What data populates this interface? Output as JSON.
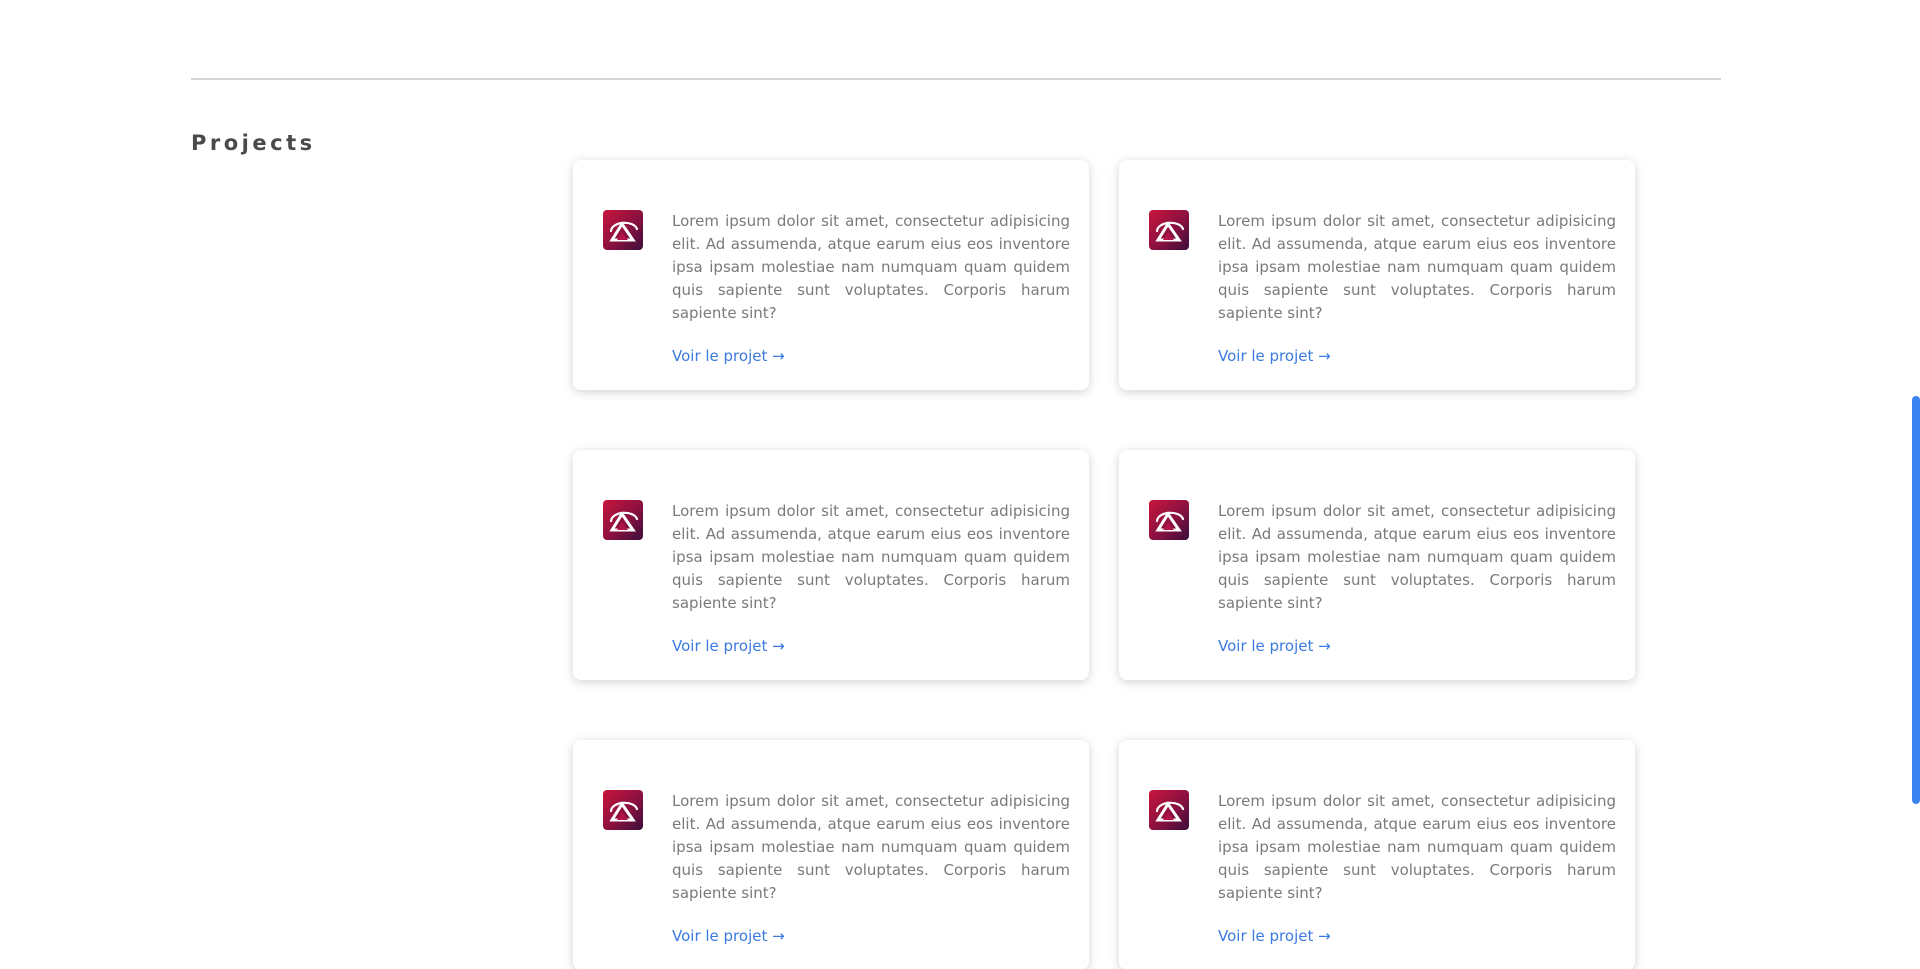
{
  "section": {
    "title": "Projects"
  },
  "projects": [
    {
      "description": "Lorem ipsum dolor sit amet, consectetur adipisicing elit. Ad assumenda, atque earum eius eos inventore ipsa ipsam molestiae nam numquam quam quidem quis sapiente sunt voluptates. Corporis harum sapiente sint?",
      "link_label": "Voir le projet →"
    },
    {
      "description": "Lorem ipsum dolor sit amet, consectetur adipisicing elit. Ad assumenda, atque earum eius eos inventore ipsa ipsam molestiae nam numquam quam quidem quis sapiente sunt voluptates. Corporis harum sapiente sint?",
      "link_label": "Voir le projet →"
    },
    {
      "description": "Lorem ipsum dolor sit amet, consectetur adipisicing elit. Ad assumenda, atque earum eius eos inventore ipsa ipsam molestiae nam numquam quam quidem quis sapiente sunt voluptates. Corporis harum sapiente sint?",
      "link_label": "Voir le projet →"
    },
    {
      "description": "Lorem ipsum dolor sit amet, consectetur adipisicing elit. Ad assumenda, atque earum eius eos inventore ipsa ipsam molestiae nam numquam quam quidem quis sapiente sunt voluptates. Corporis harum sapiente sint?",
      "link_label": "Voir le projet →"
    },
    {
      "description": "Lorem ipsum dolor sit amet, consectetur adipisicing elit. Ad assumenda, atque earum eius eos inventore ipsa ipsam molestiae nam numquam quam quidem quis sapiente sunt voluptates. Corporis harum sapiente sint?",
      "link_label": "Voir le projet →"
    },
    {
      "description": "Lorem ipsum dolor sit amet, consectetur adipisicing elit. Ad assumenda, atque earum eius eos inventore ipsa ipsam molestiae nam numquam quam quidem quis sapiente sunt voluptates. Corporis harum sapiente sint?",
      "link_label": "Voir le projet →"
    }
  ],
  "colors": {
    "accent_link": "#3b7ae0",
    "logo_start": "#c8163c",
    "logo_end": "#3a0e3a",
    "scrollbar": "#3a83f0"
  },
  "icons": {
    "project_logo": "project-logo-icon"
  }
}
